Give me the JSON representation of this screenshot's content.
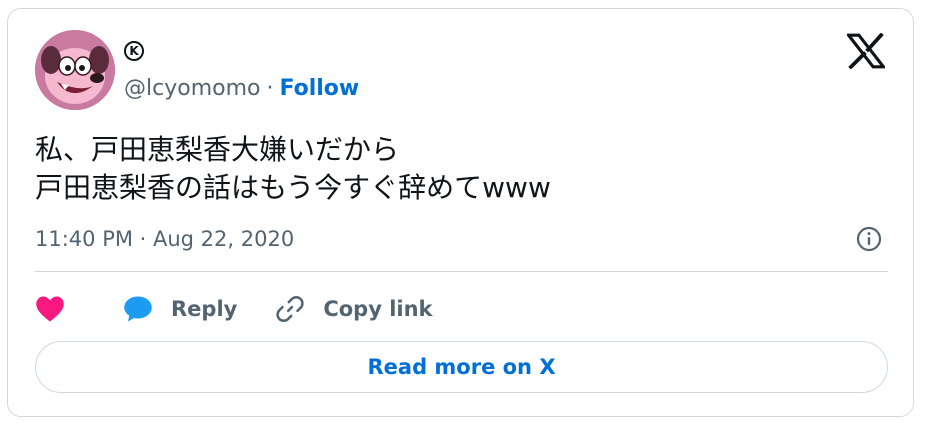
{
  "author": {
    "display_badge": "K",
    "handle": "@lcyomomo",
    "separator": "·",
    "follow_label": "Follow",
    "avatar_icon": "cartoon-dog-avatar"
  },
  "brand_icon": "x-logo-icon",
  "tweet": {
    "text": "私、戸田恵梨香大嫌いだから\n戸田恵梨香の話はもう今すぐ辞めてwww",
    "timestamp": "11:40 PM · Aug 22, 2020"
  },
  "actions": {
    "like_icon": "heart-icon",
    "reply_label": "Reply",
    "copy_label": "Copy link"
  },
  "read_more_label": "Read more on X",
  "colors": {
    "accent": "#006fd6",
    "like": "#f91880",
    "reply": "#1d9bf0",
    "text": "#0f1419",
    "muted": "#536471",
    "border": "#cfd9de"
  }
}
